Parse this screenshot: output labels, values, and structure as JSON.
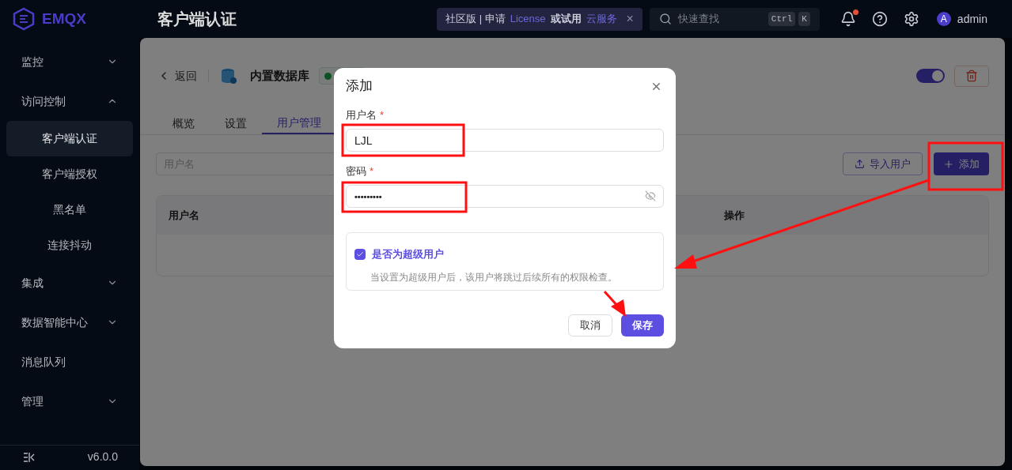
{
  "brand": {
    "name": "EMQX"
  },
  "header": {
    "title": "客户端认证",
    "banner": {
      "prefix": "社区版 | 申请",
      "link_1": "License",
      "middle": "或试用",
      "link_2": "云服务",
      "close": "×"
    },
    "search": {
      "placeholder": "快速查找",
      "keys": [
        "Ctrl",
        "K"
      ]
    },
    "notifications": {
      "unread": true
    },
    "user": {
      "avatar": "A",
      "name": "admin"
    }
  },
  "sidebar": {
    "items": [
      {
        "label": "监控",
        "kind": "group",
        "expanded": false,
        "selected": false
      },
      {
        "label": "访问控制",
        "kind": "group",
        "expanded": true,
        "selected": false
      },
      {
        "label": "客户端认证",
        "kind": "child",
        "selected": true
      },
      {
        "label": "客户端授权",
        "kind": "child",
        "selected": false
      },
      {
        "label": "黑名单",
        "kind": "child",
        "selected": false
      },
      {
        "label": "连接抖动",
        "kind": "child",
        "selected": false
      },
      {
        "label": "集成",
        "kind": "group",
        "expanded": false,
        "selected": false
      },
      {
        "label": "数据智能中心",
        "kind": "group",
        "expanded": false,
        "selected": false
      },
      {
        "label": "消息队列",
        "kind": "link",
        "selected": false
      },
      {
        "label": "管理",
        "kind": "group",
        "expanded": false,
        "selected": false
      }
    ],
    "version": "v6.0.0"
  },
  "page": {
    "back": "返回",
    "source": "内置数据库",
    "enabled": true,
    "tabs": [
      {
        "label": "概览",
        "selected": false
      },
      {
        "label": "设置",
        "selected": false
      },
      {
        "label": "用户管理",
        "selected": true
      }
    ],
    "search": {
      "placeholder": "用户名"
    },
    "import_button": "导入用户",
    "add_button": "添加",
    "table": {
      "columns": [
        "用户名",
        "操作"
      ]
    }
  },
  "modal": {
    "title": "添加",
    "fields": [
      {
        "label": "用户名",
        "required_mark": "*",
        "kind": "text",
        "value": "LJL"
      },
      {
        "label": "密码",
        "required_mark": "*",
        "kind": "password",
        "value": "•••••••••"
      }
    ],
    "superuser": {
      "label": "是否为超级用户",
      "checked": true,
      "description": "当设置为超级用户后，该用户将跳过后续所有的权限检查。"
    },
    "cancel": "取消",
    "save": "保存"
  }
}
